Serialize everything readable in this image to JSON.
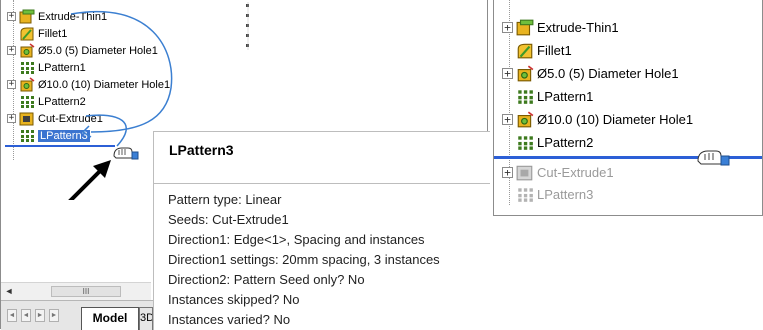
{
  "left_tree": {
    "items": [
      {
        "label": "Extrude-Thin1",
        "icon": "extrude-thin-icon",
        "expander": "+"
      },
      {
        "label": "Fillet1",
        "icon": "fillet-icon",
        "expander": ""
      },
      {
        "label": "Ø5.0 (5) Diameter Hole1",
        "icon": "hole-wizard-icon",
        "expander": "+"
      },
      {
        "label": "LPattern1",
        "icon": "linear-pattern-icon",
        "expander": ""
      },
      {
        "label": "Ø10.0 (10) Diameter Hole1",
        "icon": "hole-wizard-icon",
        "expander": "+"
      },
      {
        "label": "LPattern2",
        "icon": "linear-pattern-icon",
        "expander": ""
      },
      {
        "label": "Cut-Extrude1",
        "icon": "cut-extrude-icon",
        "expander": "+"
      },
      {
        "label": "LPattern3",
        "icon": "linear-pattern-icon",
        "expander": "",
        "selected": true
      }
    ]
  },
  "tooltip": {
    "title": "LPattern3",
    "lines": [
      "Pattern type: Linear",
      "Seeds: Cut-Extrude1",
      "Direction1: Edge<1>, Spacing and instances",
      "Direction1 settings: 20mm spacing, 3 instances",
      "Direction2: Pattern Seed only? No",
      "Instances skipped? No",
      "Instances varied? No"
    ]
  },
  "bottom": {
    "scroll_thumb": "III",
    "scroll_left": "◄",
    "model_tab": "Model",
    "tab_3d": "3D"
  },
  "right_tree": {
    "items": [
      {
        "label": "Extrude-Thin1",
        "icon": "extrude-thin-icon",
        "expander": "+"
      },
      {
        "label": "Fillet1",
        "icon": "fillet-icon",
        "expander": ""
      },
      {
        "label": "Ø5.0 (5) Diameter Hole1",
        "icon": "hole-wizard-icon",
        "expander": "+"
      },
      {
        "label": "LPattern1",
        "icon": "linear-pattern-icon",
        "expander": ""
      },
      {
        "label": "Ø10.0 (10) Diameter Hole1",
        "icon": "hole-wizard-icon",
        "expander": "+"
      },
      {
        "label": "LPattern2",
        "icon": "linear-pattern-icon",
        "expander": ""
      },
      {
        "label": "Cut-Extrude1",
        "icon": "cut-extrude-icon",
        "expander": "+",
        "greyed": true
      },
      {
        "label": "LPattern3",
        "icon": "linear-pattern-icon",
        "expander": "",
        "greyed": true
      }
    ]
  },
  "colors": {
    "drag_line": "#2c5fd6",
    "annotation_arc": "#3b7fd1",
    "selection": "#3b74d0"
  }
}
